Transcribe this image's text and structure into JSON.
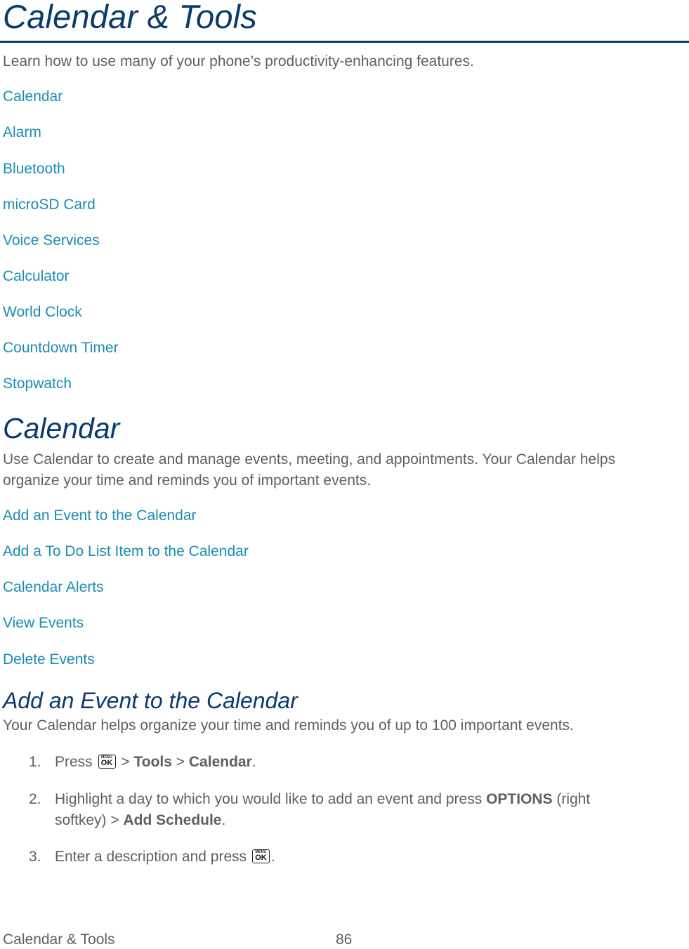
{
  "header": {
    "title": "Calendar & Tools",
    "intro": "Learn how to use many of your phone’s productivity-enhancing features."
  },
  "toc_links": [
    "Calendar",
    "Alarm",
    "Bluetooth",
    "microSD Card",
    "Voice Services",
    "Calculator",
    "World Clock",
    "Countdown Timer",
    "Stopwatch"
  ],
  "calendar_section": {
    "title": "Calendar",
    "description_line1": "Use Calendar to create and manage events, meeting, and appointments. Your Calendar helps",
    "description_line2": "organize your time and reminds you of important events.",
    "links": [
      "Add an Event to the Calendar",
      "Add a To Do List Item to the Calendar",
      "Calendar Alerts",
      "View Events",
      "Delete Events"
    ]
  },
  "add_event_section": {
    "title": "Add an Event to the Calendar",
    "description": "Your Calendar helps organize your time and reminds you of up to 100 important events.",
    "steps": [
      {
        "num": "1.",
        "pre": "Press",
        "sep1": ">",
        "bold1": "Tools",
        "sep2": ">",
        "bold2": "Calendar",
        "end": "."
      },
      {
        "num": "2.",
        "text": "Highlight a day to which you would like to add an event and press",
        "bold1": "OPTIONS",
        "text2": "(right",
        "line2_pre": "softkey) >",
        "bold2": "Add Schedule",
        "end": "."
      },
      {
        "num": "3.",
        "pre": "Enter a description and press",
        "end": "."
      }
    ],
    "key_icon": {
      "name": "menu-ok-key-icon",
      "top_label": "MENU",
      "main_label": "OK"
    }
  },
  "footer": {
    "section": "Calendar & Tools",
    "page_number": "86"
  }
}
